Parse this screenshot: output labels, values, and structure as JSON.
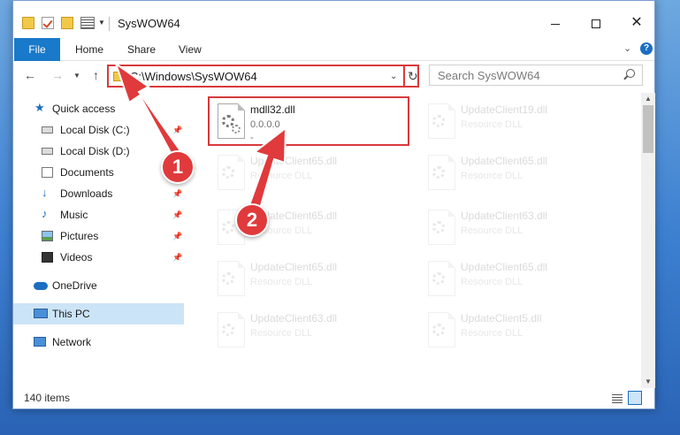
{
  "window": {
    "title": "SysWOW64"
  },
  "ribbon": {
    "file": "File",
    "home": "Home",
    "share": "Share",
    "view": "View",
    "help": "?"
  },
  "nav": {
    "address": "C:\\Windows\\SysWOW64",
    "search_placeholder": "Search SysWOW64"
  },
  "sidebar": {
    "items": [
      {
        "label": "Quick access",
        "icon": "star-icon",
        "pinned": false
      },
      {
        "label": "Local Disk (C:)",
        "icon": "drive-icon",
        "pinned": true
      },
      {
        "label": "Local Disk (D:)",
        "icon": "drive-icon",
        "pinned": false
      },
      {
        "label": "Documents",
        "icon": "documents-icon",
        "pinned": false
      },
      {
        "label": "Downloads",
        "icon": "downloads-icon",
        "pinned": true
      },
      {
        "label": "Music",
        "icon": "music-icon",
        "pinned": true
      },
      {
        "label": "Pictures",
        "icon": "pictures-icon",
        "pinned": true
      },
      {
        "label": "Videos",
        "icon": "videos-icon",
        "pinned": true
      },
      {
        "label": "OneDrive",
        "icon": "onedrive-icon",
        "pinned": false
      },
      {
        "label": "This PC",
        "icon": "pc-icon",
        "pinned": false,
        "selected": true
      },
      {
        "label": "Network",
        "icon": "network-icon",
        "pinned": false
      }
    ]
  },
  "files": [
    {
      "name": "mdll32.dll",
      "desc": "0.0.0.0",
      "extra": "-",
      "highlighted": true
    },
    {
      "name": "UpdateClient19.dll",
      "desc": "Resource DLL",
      "faded": true
    },
    {
      "name": "UpdateClient65.dll",
      "desc": "Resource DLL",
      "faded": true
    },
    {
      "name": "UpdateClient65.dll",
      "desc": "Resource DLL",
      "faded": true
    },
    {
      "name": "UpdateClient65.dll",
      "desc": "Resource DLL",
      "faded": true
    },
    {
      "name": "UpdateClient63.dll",
      "desc": "Resource DLL",
      "faded": true
    },
    {
      "name": "UpdateClient65.dll",
      "desc": "Resource DLL",
      "faded": true
    },
    {
      "name": "UpdateClient65.dll",
      "desc": "Resource DLL",
      "faded": true
    },
    {
      "name": "UpdateClient63.dll",
      "desc": "Resource DLL",
      "faded": true
    },
    {
      "name": "UpdateClient5.dll",
      "desc": "Resource DLL",
      "faded": true
    }
  ],
  "status": {
    "items": "140 items"
  },
  "annotations": {
    "step1": "1",
    "step2": "2"
  },
  "colors": {
    "accent": "#1979ca",
    "highlight": "#d9393b",
    "selected": "#cce4f7"
  }
}
